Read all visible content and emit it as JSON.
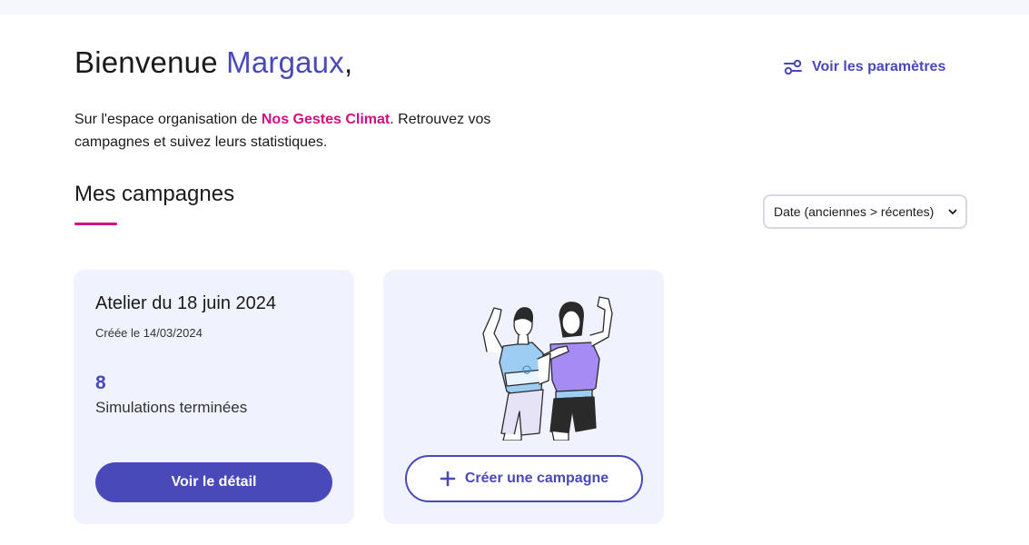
{
  "header": {
    "greeting_prefix": "Bienvenue ",
    "user_name": "Margaux",
    "greeting_suffix": ",",
    "settings_link": "Voir les paramètres"
  },
  "intro": {
    "text_before": "Sur l'espace organisation de ",
    "brand": "Nos Gestes Climat",
    "text_after": ". Retrouvez vos campagnes et suivez leurs statistiques."
  },
  "campaigns": {
    "section_title": "Mes campagnes",
    "sort_selected": "Date (anciennes > récentes)",
    "items": [
      {
        "title": "Atelier du 18 juin 2024",
        "created": "Créée le 14/03/2024",
        "count": "8",
        "count_label": "Simulations terminées",
        "button": "Voir le détail"
      }
    ],
    "create_button": "Créer une campagne"
  },
  "colors": {
    "primary": "#4949b9",
    "brand_pink": "#d40d83",
    "card_bg": "#f0f3fd"
  },
  "icons": {
    "settings": "sliders-icon",
    "sort": "chevron-down-icon",
    "create": "plus-icon"
  }
}
